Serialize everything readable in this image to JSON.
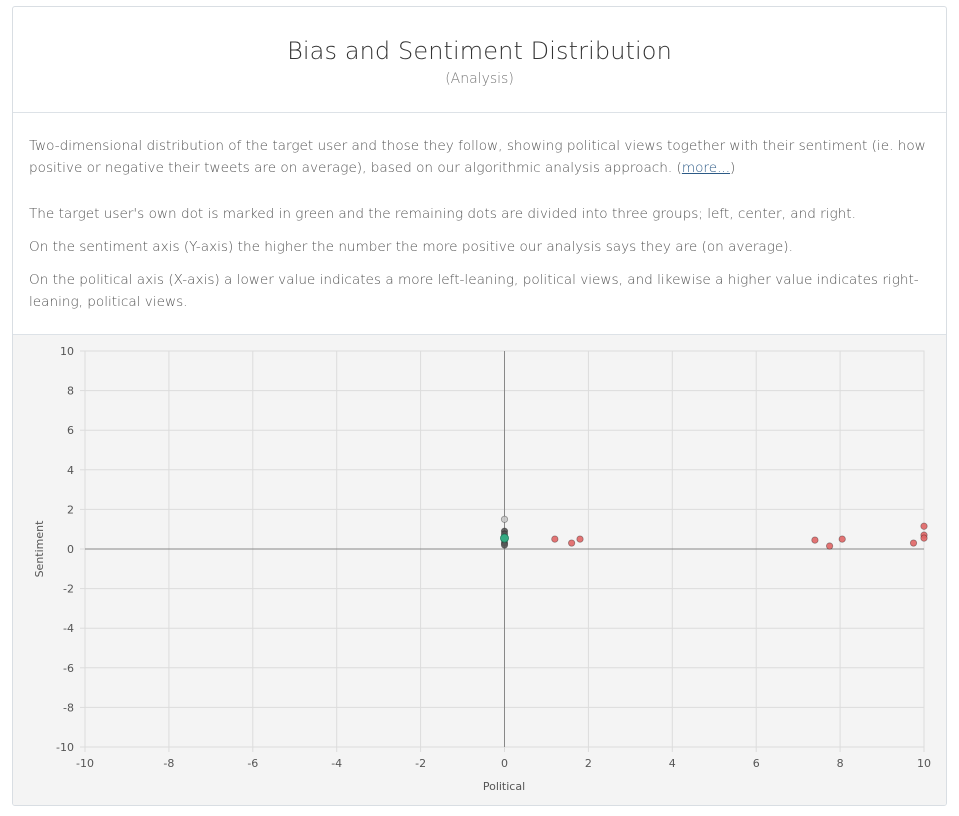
{
  "header": {
    "title": "Bias and Sentiment Distribution",
    "subtitle": "(Analysis)"
  },
  "description": {
    "p1": "Two-dimensional distribution of the target user and those they follow, showing political views together with their sentiment (ie. how positive or negative their tweets are on average), based on our algorithmic analysis approach.",
    "more_link_prefix": "(",
    "more_link_label": "more...",
    "more_link_suffix": ")",
    "p2": "The target user's own dot is marked in green and the remaining dots are divided into three groups; left, center, and right.",
    "p3": "On the sentiment axis (Y-axis) the higher the number the more positive our analysis says they are (on average).",
    "p4": "On the political axis (X-axis) a lower value indicates a more left-leaning, political views, and likewise a higher value indicates right-leaning, political views."
  },
  "colors": {
    "right_group": "#e06666",
    "center_group": "#555555",
    "target_user": "#33b58a",
    "faded_point": "#c8c8c8",
    "grid": "#dcdcdc",
    "axis": "#888888"
  },
  "chart_data": {
    "type": "scatter",
    "title": "",
    "xlabel": "Political",
    "ylabel": "Sentiment",
    "xlim": [
      -10,
      10
    ],
    "ylim": [
      -10,
      10
    ],
    "xticks": [
      -10,
      -8,
      -6,
      -4,
      -2,
      0,
      2,
      4,
      6,
      8,
      10
    ],
    "yticks": [
      10,
      8,
      6,
      4,
      2,
      0,
      -2,
      -4,
      -6,
      -8,
      -10
    ],
    "grid": true,
    "legend": "none",
    "series": [
      {
        "group": "center",
        "color": "#555555",
        "points": [
          [
            0,
            0.9
          ],
          [
            0,
            0.75
          ],
          [
            0,
            0.6
          ],
          [
            0,
            0.45
          ],
          [
            0,
            0.3
          ],
          [
            0,
            0.2
          ]
        ]
      },
      {
        "group": "center-faded",
        "color": "#c8c8c8",
        "points": [
          [
            0,
            1.5
          ]
        ]
      },
      {
        "group": "right",
        "color": "#e06666",
        "points": [
          [
            1.2,
            0.5
          ],
          [
            1.6,
            0.3
          ],
          [
            1.8,
            0.5
          ],
          [
            7.4,
            0.45
          ],
          [
            7.75,
            0.15
          ],
          [
            8.05,
            0.5
          ],
          [
            9.75,
            0.3
          ],
          [
            10,
            1.15
          ],
          [
            10,
            0.7
          ],
          [
            10,
            0.55
          ]
        ]
      },
      {
        "group": "target",
        "color": "#33b58a",
        "points": [
          [
            0,
            0.55
          ]
        ]
      }
    ]
  }
}
